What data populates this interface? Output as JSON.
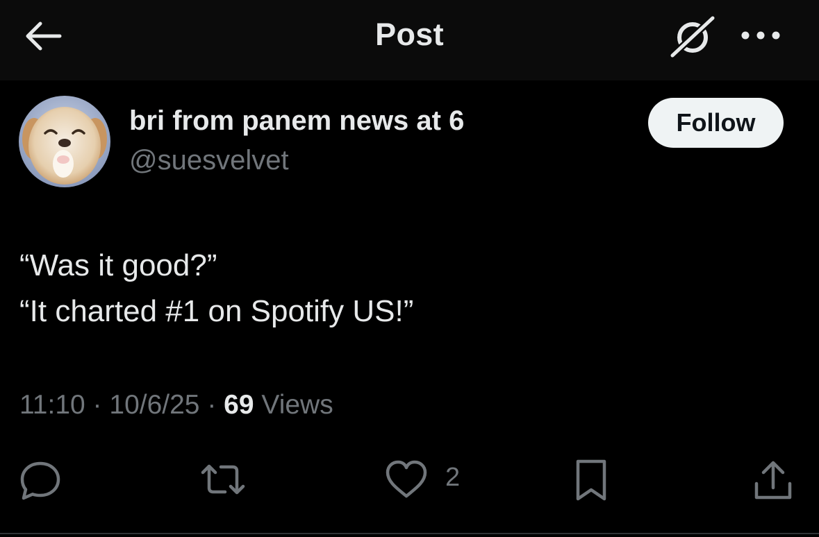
{
  "header": {
    "title": "Post",
    "back_icon": "arrow-left-icon",
    "grok_icon": "grok-icon",
    "more_icon": "more-horizontal-icon"
  },
  "author": {
    "display_name": "bri from panem news at 6",
    "handle": "@suesvelvet",
    "avatar": "puppy-avatar"
  },
  "follow_button": {
    "label": "Follow"
  },
  "post": {
    "lines": [
      "“Was it good?”",
      "“It charted #1 on Spotify US!”"
    ]
  },
  "meta": {
    "time": "11:10",
    "separator": " · ",
    "date": "10/6/25",
    "views_count": "69",
    "views_label": " Views"
  },
  "actions": {
    "reply_icon": "reply-icon",
    "repost_icon": "repost-icon",
    "like_icon": "heart-icon",
    "like_count": "2",
    "bookmark_icon": "bookmark-icon",
    "share_icon": "share-icon"
  },
  "colors": {
    "background": "#000000",
    "header_background": "#0b0b0b",
    "primary_text": "#e7e9ea",
    "secondary_text": "#71767b",
    "follow_button_bg": "#eff3f4",
    "follow_button_text": "#0f1419"
  }
}
